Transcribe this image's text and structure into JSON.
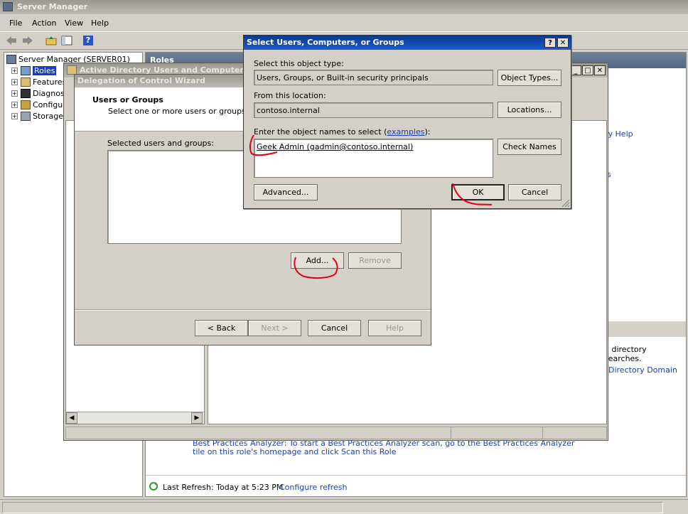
{
  "server_manager": {
    "title": "Server Manager",
    "menu": [
      "File",
      "Action",
      "View",
      "Help"
    ],
    "tree": [
      {
        "label": "Server Manager (SERVER01)"
      },
      {
        "label": "Roles"
      },
      {
        "label": "Features"
      },
      {
        "label": "Diagnost"
      },
      {
        "label": "Configur"
      },
      {
        "label": "Storage"
      }
    ],
    "roles_header": "Roles",
    "right_links": {
      "help": "ry Help",
      "s": "s",
      "searches": "d directory searches.",
      "domain": "Directory Domain"
    },
    "bpa_text_line1": "Best Practices Analyzer: To start a Best Practices Analyzer scan, go to the Best Practices Analyzer",
    "bpa_text_line2": "tile on this role's homepage and click Scan this Role",
    "last_refresh": "Last Refresh: Today at 5:23 PM",
    "configure_refresh": "Configure refresh"
  },
  "aduc": {
    "title": "Active Directory Users and Computers"
  },
  "wizard": {
    "title": "Delegation of Control Wizard",
    "heading": "Users or Groups",
    "subheading": "Select one or more users or groups to wh",
    "selected_label": "Selected users and groups:",
    "add_button": "Add...",
    "remove_button": "Remove",
    "back_button": "< Back",
    "next_button": "Next >",
    "cancel_button": "Cancel",
    "help_button": "Help"
  },
  "select_dialog": {
    "title": "Select Users, Computers, or Groups",
    "object_type_label": "Select this object type:",
    "object_type_value": "Users, Groups, or Built-in security principals",
    "object_types_button": "Object Types...",
    "location_label": "From this location:",
    "location_value": "contoso.internal",
    "locations_button": "Locations...",
    "names_label_prefix": "Enter the object names to select (",
    "names_label_link": "examples",
    "names_label_suffix": "):",
    "names_value": "Geek Admin (gadmin@contoso.internal)",
    "check_names_button": "Check Names",
    "advanced_button": "Advanced...",
    "ok_button": "OK",
    "cancel_button": "Cancel"
  },
  "colors": {
    "active_title": "#0b3a8c",
    "link": "#1a3fb5",
    "annotation": "#e0001a"
  }
}
